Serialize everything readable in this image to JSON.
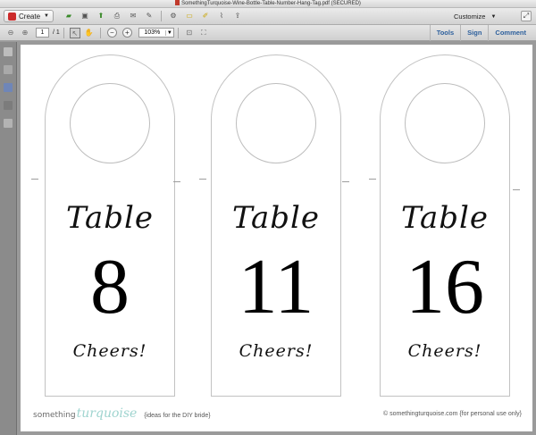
{
  "window": {
    "title": "SomethingTurquoise-Wine-Bottle-Table-Number-Hang-Tag.pdf (SECURED)"
  },
  "toolbar": {
    "create_label": "Create",
    "customize_label": "Customize",
    "icons": [
      "open-folder-icon",
      "save-icon",
      "upload-icon",
      "print-icon",
      "email-icon",
      "edit-icon",
      "settings-icon",
      "comment-icon",
      "highlight-icon",
      "attach-icon",
      "share-icon"
    ]
  },
  "nav": {
    "current_page": "1",
    "total_pages": "/ 1",
    "zoom": "103%",
    "links": [
      "Tools",
      "Sign",
      "Comment"
    ]
  },
  "document": {
    "tags": [
      {
        "word": "Table",
        "number": "8",
        "closing": "Cheers!"
      },
      {
        "word": "Table",
        "number": "11",
        "closing": "Cheers!"
      },
      {
        "word": "Table",
        "number": "16",
        "closing": "Cheers!"
      }
    ],
    "footer": {
      "logo_part1": "something",
      "logo_part2": "turquoise",
      "tagline": "{ideas for the DIY bride}",
      "credit": "© somethingturquoise.com {for personal use only}"
    }
  },
  "colors": {
    "accent_link": "#2d5f9c",
    "logo_turquoise": "#9fd4cf"
  }
}
